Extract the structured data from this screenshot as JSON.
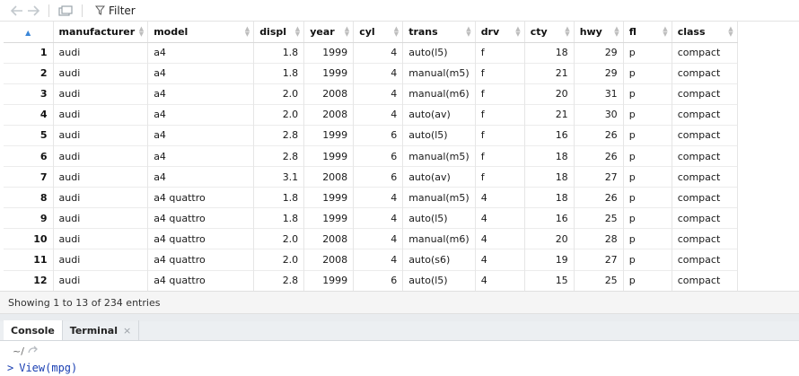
{
  "toolbar": {
    "back_icon": "arrow-left-icon",
    "forward_icon": "arrow-right-icon",
    "popout_icon": "popout-window-icon",
    "filter_icon": "funnel-icon",
    "filter_label": "Filter"
  },
  "table": {
    "columns": [
      "manufacturer",
      "model",
      "displ",
      "year",
      "cyl",
      "trans",
      "drv",
      "cty",
      "hwy",
      "fl",
      "class"
    ],
    "rows": [
      {
        "n": "1",
        "cells": [
          "audi",
          "a4",
          "1.8",
          "1999",
          "4",
          "auto(l5)",
          "f",
          "18",
          "29",
          "p",
          "compact"
        ]
      },
      {
        "n": "2",
        "cells": [
          "audi",
          "a4",
          "1.8",
          "1999",
          "4",
          "manual(m5)",
          "f",
          "21",
          "29",
          "p",
          "compact"
        ]
      },
      {
        "n": "3",
        "cells": [
          "audi",
          "a4",
          "2.0",
          "2008",
          "4",
          "manual(m6)",
          "f",
          "20",
          "31",
          "p",
          "compact"
        ]
      },
      {
        "n": "4",
        "cells": [
          "audi",
          "a4",
          "2.0",
          "2008",
          "4",
          "auto(av)",
          "f",
          "21",
          "30",
          "p",
          "compact"
        ]
      },
      {
        "n": "5",
        "cells": [
          "audi",
          "a4",
          "2.8",
          "1999",
          "6",
          "auto(l5)",
          "f",
          "16",
          "26",
          "p",
          "compact"
        ]
      },
      {
        "n": "6",
        "cells": [
          "audi",
          "a4",
          "2.8",
          "1999",
          "6",
          "manual(m5)",
          "f",
          "18",
          "26",
          "p",
          "compact"
        ]
      },
      {
        "n": "7",
        "cells": [
          "audi",
          "a4",
          "3.1",
          "2008",
          "6",
          "auto(av)",
          "f",
          "18",
          "27",
          "p",
          "compact"
        ]
      },
      {
        "n": "8",
        "cells": [
          "audi",
          "a4 quattro",
          "1.8",
          "1999",
          "4",
          "manual(m5)",
          "4",
          "18",
          "26",
          "p",
          "compact"
        ]
      },
      {
        "n": "9",
        "cells": [
          "audi",
          "a4 quattro",
          "1.8",
          "1999",
          "4",
          "auto(l5)",
          "4",
          "16",
          "25",
          "p",
          "compact"
        ]
      },
      {
        "n": "10",
        "cells": [
          "audi",
          "a4 quattro",
          "2.0",
          "2008",
          "4",
          "manual(m6)",
          "4",
          "20",
          "28",
          "p",
          "compact"
        ]
      },
      {
        "n": "11",
        "cells": [
          "audi",
          "a4 quattro",
          "2.0",
          "2008",
          "4",
          "auto(s6)",
          "4",
          "19",
          "27",
          "p",
          "compact"
        ]
      },
      {
        "n": "12",
        "cells": [
          "audi",
          "a4 quattro",
          "2.8",
          "1999",
          "6",
          "auto(l5)",
          "4",
          "15",
          "25",
          "p",
          "compact"
        ]
      }
    ]
  },
  "status": {
    "text": "Showing 1 to 13 of 234 entries"
  },
  "tabs": [
    {
      "label": "Console",
      "active": true
    },
    {
      "label": "Terminal",
      "active": false
    }
  ],
  "console": {
    "path": "~/",
    "prompt": ">",
    "command": "View(mpg)"
  },
  "colors": {
    "sort_active": "#3a86d8",
    "console_text": "#1a3fb3",
    "status_bg": "#f5f5f5"
  }
}
